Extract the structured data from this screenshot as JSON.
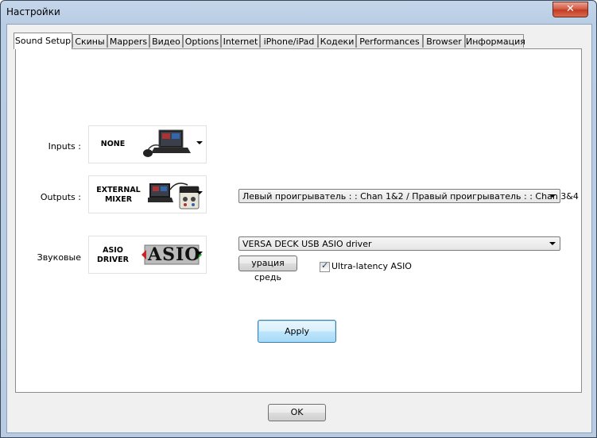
{
  "window": {
    "title": "Настройки",
    "close_glyph": "✕"
  },
  "tabs": [
    {
      "label": "Sound Setup",
      "active": true
    },
    {
      "label": "Скины"
    },
    {
      "label": "Mappers"
    },
    {
      "label": "Видео"
    },
    {
      "label": "Options"
    },
    {
      "label": "Internet"
    },
    {
      "label": "iPhone/iPad"
    },
    {
      "label": "Кодеки"
    },
    {
      "label": "Performances"
    },
    {
      "label": "Browser"
    },
    {
      "label": "Информация"
    }
  ],
  "sound_setup": {
    "inputs": {
      "label": "Inputs :",
      "selection": "NONE",
      "icon": "laptop-with-headphones-icon"
    },
    "outputs": {
      "label": "Outputs :",
      "selection_line1": "EXTERNAL",
      "selection_line2": "MIXER",
      "icon": "laptop-with-mixer-icon",
      "channel_value": "Левый проигрыватель : : Chan 1&2 / Правый проигрыватель : : Chan 3&4"
    },
    "sound": {
      "label": "Звуковые",
      "selection_line1": "ASIO",
      "selection_line2": "DRIVER",
      "logo_text": "ASIO",
      "driver_value": "VERSA DECK USB ASIO driver",
      "config_button": "урация средь",
      "ultra_latency_label": "Ultra-latency ASIO",
      "ultra_latency_checked": true
    },
    "apply_button": "Apply"
  },
  "ok_button": "OK"
}
